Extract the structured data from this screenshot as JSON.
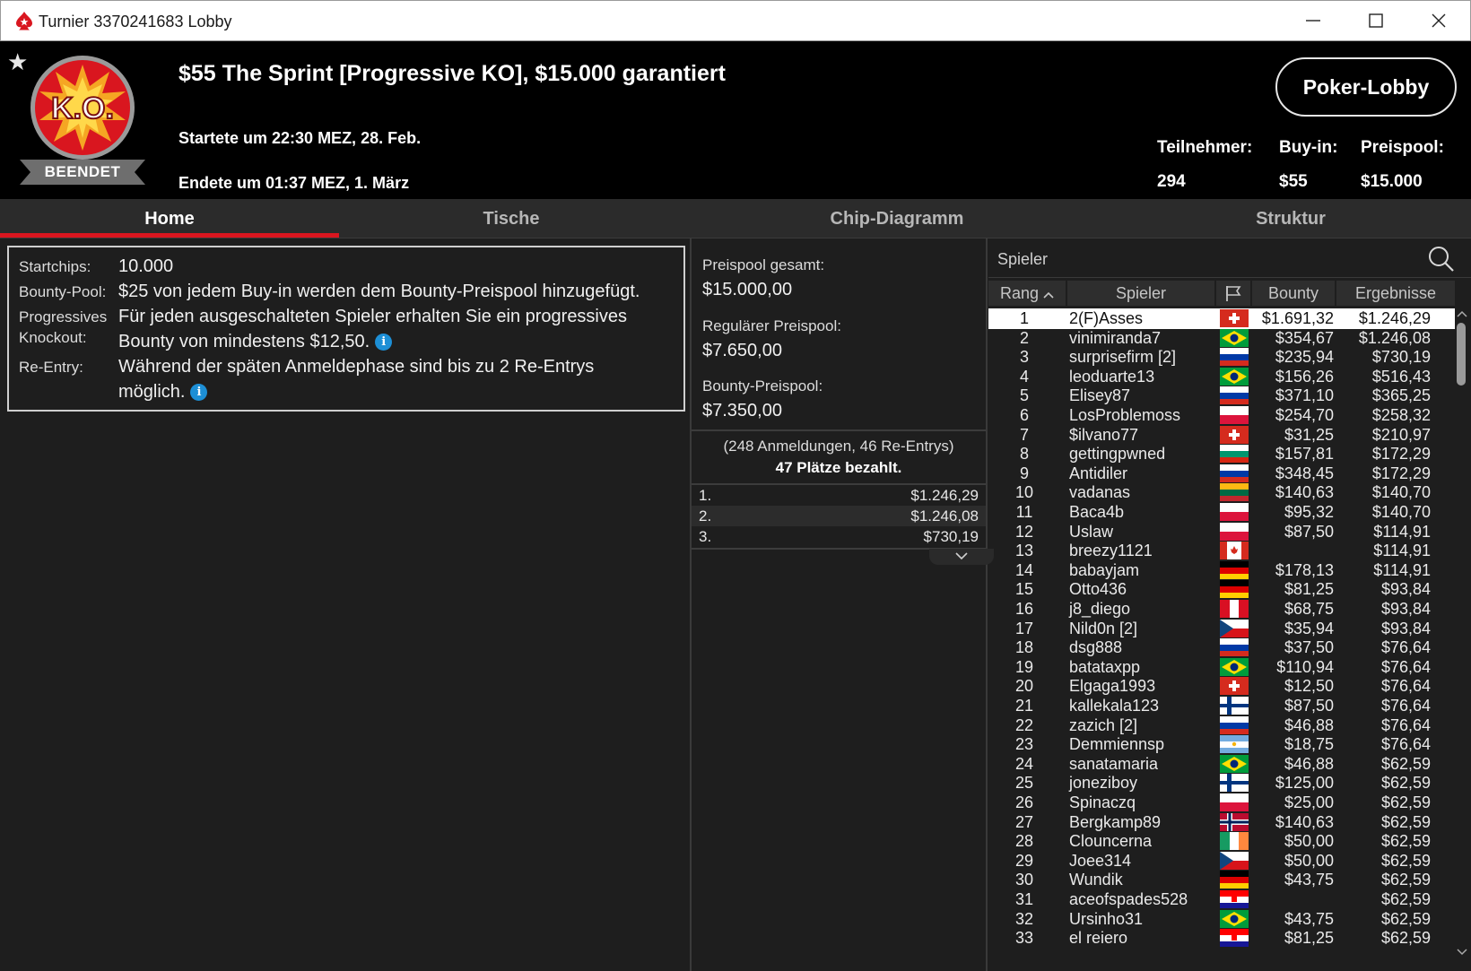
{
  "window": {
    "title": "Turnier 3370241683 Lobby"
  },
  "header": {
    "tournament_title": "$55 The Sprint [Progressive KO], $15.000 garantiert",
    "started": "Startete um 22:30 MEZ, 28. Feb.",
    "ended": "Endete um 01:37 MEZ, 1. März",
    "status": "BEENDET",
    "logo_text": "K.O.",
    "lobby_button": "Poker-Lobby",
    "stats": [
      {
        "label": "Teilnehmer:",
        "value": "294"
      },
      {
        "label": "Buy-in:",
        "value": "$55"
      },
      {
        "label": "Preispool:",
        "value": "$15.000"
      }
    ]
  },
  "tabs": [
    "Home",
    "Tische",
    "Chip-Diagramm",
    "Struktur"
  ],
  "home": {
    "startchips_label": "Startchips:",
    "startchips_value": "10.000",
    "bounty_label": "Bounty-Pool:",
    "bounty_value": "$25 von jedem Buy-in werden dem Bounty-Preispool hinzugefügt.",
    "progressive_label_1": "Progressives",
    "progressive_label_2": "Knockout:",
    "progressive_value_1": "Für jeden ausgeschalteten Spieler erhalten Sie ein progressives",
    "progressive_value_2": "Bounty von mindestens $12,50.",
    "reentry_label": "Re-Entry:",
    "reentry_value_1": "Während der späten Anmeldephase sind bis zu 2 Re-Entrys",
    "reentry_value_2": "möglich."
  },
  "prizepool": {
    "total_label": "Preispool gesamt:",
    "total_value": "$15.000,00",
    "regular_label": "Regulärer Preispool:",
    "regular_value": "$7.650,00",
    "bounty_label": "Bounty-Preispool:",
    "bounty_value": "$7.350,00",
    "entries": "(248 Anmeldungen, 46 Re-Entrys)",
    "paid": "47 Plätze bezahlt.",
    "payouts": [
      {
        "pos": "1.",
        "amount": "$1.246,29"
      },
      {
        "pos": "2.",
        "amount": "$1.246,08"
      },
      {
        "pos": "3.",
        "amount": "$730,19"
      }
    ]
  },
  "players": {
    "search_placeholder": "Spieler",
    "columns": {
      "rank": "Rang",
      "player": "Spieler",
      "bounty": "Bounty",
      "result": "Ergebnisse"
    },
    "rows": [
      {
        "rank": "1",
        "name": "2(F)Asses",
        "flag": "ch",
        "bounty": "$1.691,32",
        "result": "$1.246,29"
      },
      {
        "rank": "2",
        "name": "vinimiranda7",
        "flag": "br",
        "bounty": "$354,67",
        "result": "$1.246,08"
      },
      {
        "rank": "3",
        "name": "surprisefirm [2]",
        "flag": "ru",
        "bounty": "$235,94",
        "result": "$730,19"
      },
      {
        "rank": "4",
        "name": "leoduarte13",
        "flag": "br",
        "bounty": "$156,26",
        "result": "$516,43"
      },
      {
        "rank": "5",
        "name": "Elisey87",
        "flag": "ru",
        "bounty": "$371,10",
        "result": "$365,25"
      },
      {
        "rank": "6",
        "name": "LosProblemoss",
        "flag": "pl",
        "bounty": "$254,70",
        "result": "$258,32"
      },
      {
        "rank": "7",
        "name": "$ilvano77",
        "flag": "ch",
        "bounty": "$31,25",
        "result": "$210,97"
      },
      {
        "rank": "8",
        "name": "gettingpwned",
        "flag": "bg",
        "bounty": "$157,81",
        "result": "$172,29"
      },
      {
        "rank": "9",
        "name": "Antidiler",
        "flag": "ru",
        "bounty": "$348,45",
        "result": "$172,29"
      },
      {
        "rank": "10",
        "name": "vadanas",
        "flag": "lt",
        "bounty": "$140,63",
        "result": "$140,70"
      },
      {
        "rank": "11",
        "name": "Baca4b",
        "flag": "pl",
        "bounty": "$95,32",
        "result": "$140,70"
      },
      {
        "rank": "12",
        "name": "Uslaw",
        "flag": "pl",
        "bounty": "$87,50",
        "result": "$114,91"
      },
      {
        "rank": "13",
        "name": "breezy1121",
        "flag": "ca",
        "bounty": "",
        "result": "$114,91"
      },
      {
        "rank": "14",
        "name": "babayjam",
        "flag": "de",
        "bounty": "$178,13",
        "result": "$114,91"
      },
      {
        "rank": "15",
        "name": "Otto436",
        "flag": "de",
        "bounty": "$81,25",
        "result": "$93,84"
      },
      {
        "rank": "16",
        "name": "j8_diego",
        "flag": "pe",
        "bounty": "$68,75",
        "result": "$93,84"
      },
      {
        "rank": "17",
        "name": "Nild0n [2]",
        "flag": "cz",
        "bounty": "$35,94",
        "result": "$93,84"
      },
      {
        "rank": "18",
        "name": "dsg888",
        "flag": "ru",
        "bounty": "$37,50",
        "result": "$76,64"
      },
      {
        "rank": "19",
        "name": "batataxpp",
        "flag": "br",
        "bounty": "$110,94",
        "result": "$76,64"
      },
      {
        "rank": "20",
        "name": "Elgaga1993",
        "flag": "ch",
        "bounty": "$12,50",
        "result": "$76,64"
      },
      {
        "rank": "21",
        "name": "kallekala123",
        "flag": "fi",
        "bounty": "$87,50",
        "result": "$76,64"
      },
      {
        "rank": "22",
        "name": "zazich [2]",
        "flag": "ru",
        "bounty": "$46,88",
        "result": "$76,64"
      },
      {
        "rank": "23",
        "name": "Demmiennsp",
        "flag": "ar",
        "bounty": "$18,75",
        "result": "$76,64"
      },
      {
        "rank": "24",
        "name": "sanatamaria",
        "flag": "br",
        "bounty": "$46,88",
        "result": "$62,59"
      },
      {
        "rank": "25",
        "name": "joneziboy",
        "flag": "fi",
        "bounty": "$125,00",
        "result": "$62,59"
      },
      {
        "rank": "26",
        "name": "Spinaczq",
        "flag": "pl",
        "bounty": "$25,00",
        "result": "$62,59"
      },
      {
        "rank": "27",
        "name": "Bergkamp89",
        "flag": "no",
        "bounty": "$140,63",
        "result": "$62,59"
      },
      {
        "rank": "28",
        "name": "Clouncerna",
        "flag": "ie",
        "bounty": "$50,00",
        "result": "$62,59"
      },
      {
        "rank": "29",
        "name": "Joee314",
        "flag": "cz",
        "bounty": "$50,00",
        "result": "$62,59"
      },
      {
        "rank": "30",
        "name": "Wundik",
        "flag": "de",
        "bounty": "$43,75",
        "result": "$62,59"
      },
      {
        "rank": "31",
        "name": "aceofspades528",
        "flag": "hr",
        "bounty": "",
        "result": "$62,59"
      },
      {
        "rank": "32",
        "name": "Ursinho31",
        "flag": "br",
        "bounty": "$43,75",
        "result": "$62,59"
      },
      {
        "rank": "33",
        "name": "el reiero",
        "flag": "hr",
        "bounty": "$81,25",
        "result": "$62,59"
      }
    ]
  },
  "colors": {
    "accent": "#d9161f",
    "background": "#1e1e1e",
    "header": "#000000",
    "info": "#1d8fd6"
  }
}
